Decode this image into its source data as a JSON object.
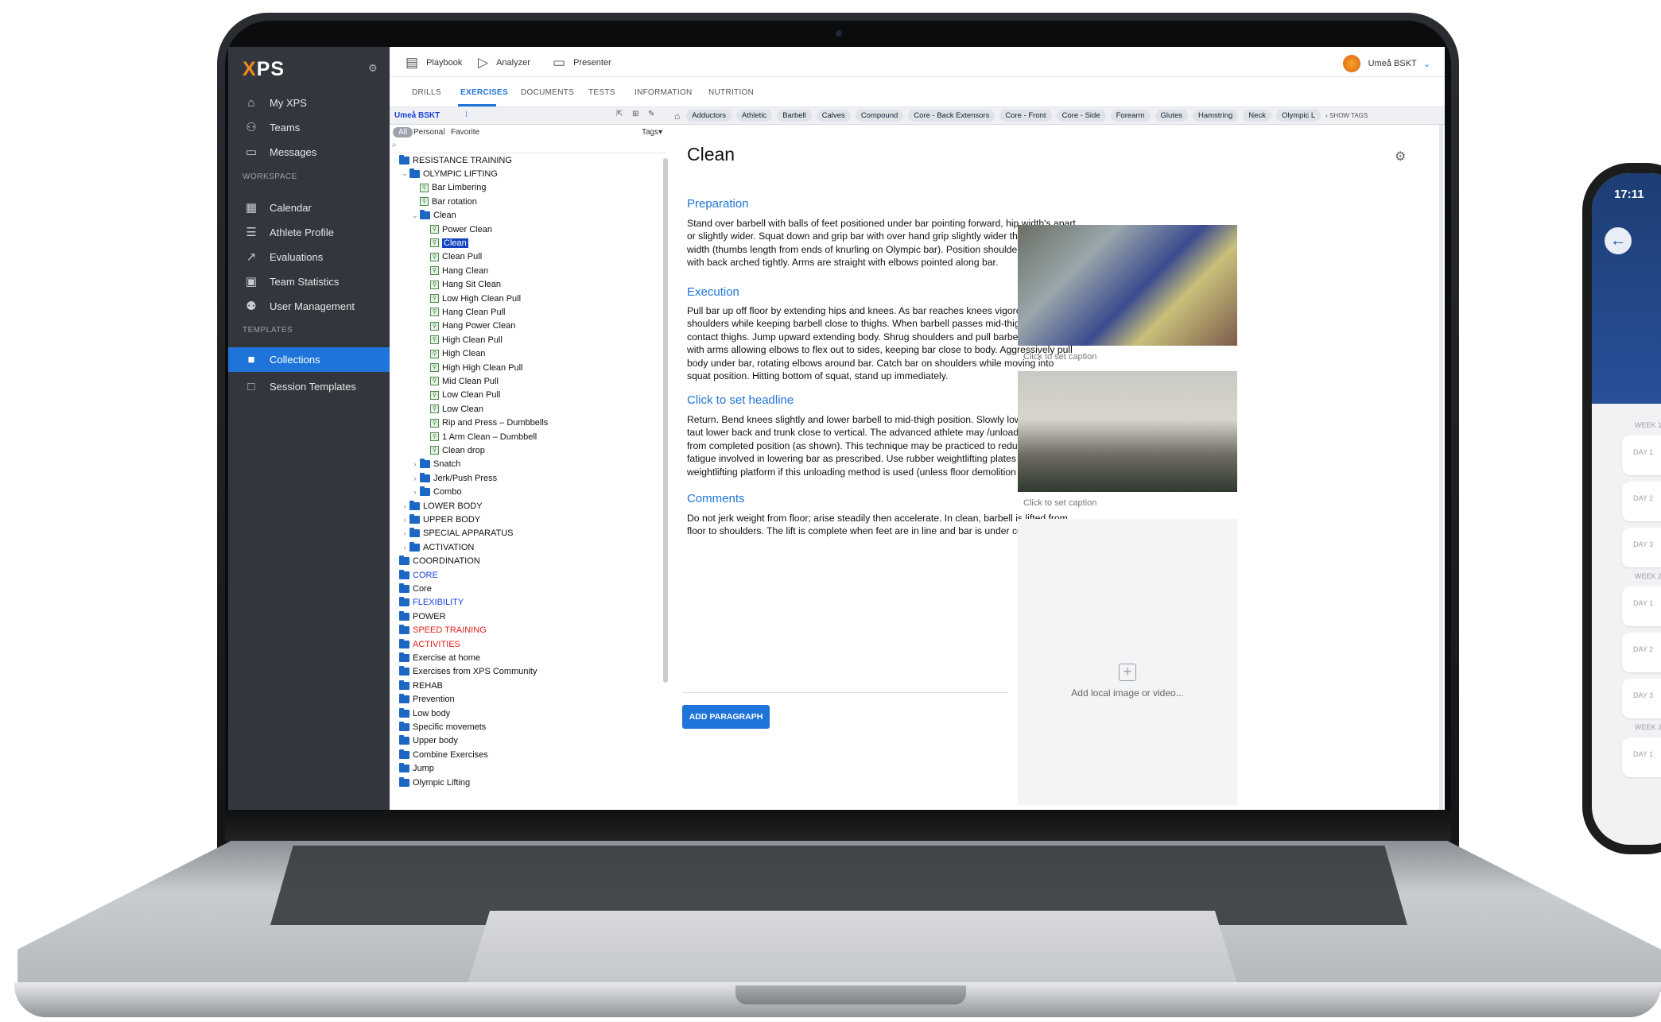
{
  "app": {
    "logo": "XPS",
    "sidebar": {
      "items": [
        {
          "label": "My XPS",
          "icon": "home-icon"
        },
        {
          "label": "Teams",
          "icon": "teams-icon"
        },
        {
          "label": "Messages",
          "icon": "chat-icon"
        }
      ],
      "workspace_label": "WORKSPACE",
      "workspace_items": [
        {
          "label": "Calendar",
          "icon": "calendar-icon"
        },
        {
          "label": "Athlete Profile",
          "icon": "profile-icon"
        },
        {
          "label": "Evaluations",
          "icon": "chart-icon"
        },
        {
          "label": "Team Statistics",
          "icon": "stats-icon"
        },
        {
          "label": "User Management",
          "icon": "users-icon"
        }
      ],
      "templates_label": "TEMPLATES",
      "template_items": [
        {
          "label": "Collections",
          "icon": "folder-icon",
          "active": true
        },
        {
          "label": "Session Templates",
          "icon": "folder-outline-icon"
        }
      ]
    },
    "topbar": {
      "playbook": "Playbook",
      "analyzer": "Analyzer",
      "presenter": "Presenter",
      "team": "Umeå BSKT"
    },
    "subnav": [
      "DRILLS",
      "EXERCISES",
      "DOCUMENTS",
      "TESTS",
      "INFORMATION",
      "NUTRITION"
    ],
    "subnav_active": "EXERCISES",
    "tree_header": {
      "team": "Umeå BSKT"
    },
    "filters": {
      "all": "All",
      "personal": "Personal",
      "favorite": "Favorite",
      "tags": "Tags"
    },
    "tree": [
      {
        "label": "RESISTANCE TRAINING",
        "level": 0,
        "kind": "folder"
      },
      {
        "label": "OLYMPIC LIFTING",
        "level": 1,
        "kind": "folder",
        "open": true
      },
      {
        "label": "Bar Limbering",
        "level": 2,
        "kind": "doc"
      },
      {
        "label": "Bar rotation",
        "level": 2,
        "kind": "doc"
      },
      {
        "label": "Clean",
        "level": 2,
        "kind": "folder",
        "open": true
      },
      {
        "label": "Power Clean",
        "level": 3,
        "kind": "doc"
      },
      {
        "label": "Clean",
        "level": 3,
        "kind": "doc",
        "selected": true
      },
      {
        "label": "Clean Pull",
        "level": 3,
        "kind": "doc"
      },
      {
        "label": "Hang Clean",
        "level": 3,
        "kind": "doc"
      },
      {
        "label": "Hang Sit Clean",
        "level": 3,
        "kind": "doc"
      },
      {
        "label": "Low High Clean Pull",
        "level": 3,
        "kind": "doc"
      },
      {
        "label": "Hang Clean Pull",
        "level": 3,
        "kind": "doc"
      },
      {
        "label": "Hang Power Clean",
        "level": 3,
        "kind": "doc"
      },
      {
        "label": "High Clean Pull",
        "level": 3,
        "kind": "doc"
      },
      {
        "label": "High Clean",
        "level": 3,
        "kind": "doc"
      },
      {
        "label": "High High Clean Pull",
        "level": 3,
        "kind": "doc"
      },
      {
        "label": "Mid Clean Pull",
        "level": 3,
        "kind": "doc"
      },
      {
        "label": "Low Clean Pull",
        "level": 3,
        "kind": "doc"
      },
      {
        "label": "Low Clean",
        "level": 3,
        "kind": "doc"
      },
      {
        "label": "Rip and Press – Dumbbells",
        "level": 3,
        "kind": "doc"
      },
      {
        "label": "1 Arm Clean – Dumbbell",
        "level": 3,
        "kind": "doc"
      },
      {
        "label": "Clean drop",
        "level": 3,
        "kind": "doc"
      },
      {
        "label": "Snatch",
        "level": 2,
        "kind": "folder",
        "collapsed": true
      },
      {
        "label": "Jerk/Push Press",
        "level": 2,
        "kind": "folder",
        "collapsed": true
      },
      {
        "label": "Combo",
        "level": 2,
        "kind": "folder",
        "collapsed": true
      },
      {
        "label": "LOWER BODY",
        "level": 1,
        "kind": "folder",
        "collapsed": true
      },
      {
        "label": "UPPER BODY",
        "level": 1,
        "kind": "folder",
        "collapsed": true
      },
      {
        "label": "SPECIAL APPARATUS",
        "level": 1,
        "kind": "folder",
        "collapsed": true
      },
      {
        "label": "ACTIVATION",
        "level": 1,
        "kind": "folder",
        "collapsed": true
      },
      {
        "label": "COORDINATION",
        "level": 0,
        "kind": "folder"
      },
      {
        "label": "CORE",
        "level": 0,
        "kind": "folder",
        "color": "blue"
      },
      {
        "label": "Core",
        "level": 0,
        "kind": "folder"
      },
      {
        "label": "FLEXIBILITY",
        "level": 0,
        "kind": "folder",
        "color": "blue"
      },
      {
        "label": "POWER",
        "level": 0,
        "kind": "folder"
      },
      {
        "label": "SPEED TRAINING",
        "level": 0,
        "kind": "folder",
        "color": "red"
      },
      {
        "label": "ACTIVITIES",
        "level": 0,
        "kind": "folder",
        "color": "red"
      },
      {
        "label": "Exercise at home",
        "level": 0,
        "kind": "folder"
      },
      {
        "label": "Exercises from XPS Community",
        "level": 0,
        "kind": "folder"
      },
      {
        "label": "REHAB",
        "level": 0,
        "kind": "folder"
      },
      {
        "label": "Prevention",
        "level": 0,
        "kind": "folder"
      },
      {
        "label": "Low body",
        "level": 0,
        "kind": "folder"
      },
      {
        "label": "Specific movemets",
        "level": 0,
        "kind": "folder"
      },
      {
        "label": "Upper body",
        "level": 0,
        "kind": "folder"
      },
      {
        "label": "Combine Exercises",
        "level": 0,
        "kind": "folder"
      },
      {
        "label": "Jump",
        "level": 0,
        "kind": "folder"
      },
      {
        "label": "Olympic Lifting",
        "level": 0,
        "kind": "folder"
      }
    ],
    "tags": [
      "Adductors",
      "Athletic",
      "Barbell",
      "Calves",
      "Compound",
      "Core - Back Extensors",
      "Core - Front",
      "Core - Side",
      "Forearm",
      "Glutes",
      "Hamstring",
      "Neck",
      "Olympic L"
    ],
    "show_tags": "‹ SHOW TAGS",
    "detail": {
      "title": "Clean",
      "sections": [
        {
          "headline": "Preparation",
          "text": "Stand over barbell with balls of feet positioned under bar pointing forward, hip width's apart or slightly wider. Squat down and grip bar with over hand grip slightly wider than shoulder width (thumbs length from ends of knurling on Olympic bar). Position shoulders over bar with back arched tightly. Arms are straight with elbows pointed along bar."
        },
        {
          "headline": "Execution",
          "text": "Pull bar up off floor by extending hips and knees. As bar reaches knees vigorously raise shoulders while keeping barbell close to thighs. When barbell passes mid-thigh, allow it to contact thighs. Jump upward extending body. Shrug shoulders and pull barbell upward with arms allowing elbows to flex out to sides, keeping bar close to body. Aggressively pull body under bar, rotating elbows around bar. Catch bar on shoulders while moving into squat position. Hitting bottom of squat, stand up immediately."
        },
        {
          "headline": "Click to set headline",
          "text": "Return. Bend knees slightly and lower barbell to mid-thigh position. Slowly lower bar with taut lower back and trunk close to vertical. The advanced athlete may /unload/ (drop) bar from completed position (as shown). This technique may be practiced to reduce stress or fatigue involved in lowering bar as prescribed. Use rubber weightlifting plates on weightlifting platform if this unloading method is used (unless floor demolition is desired)."
        },
        {
          "headline": "Comments",
          "text": "Do not jerk weight from floor; arise steadily then accelerate. In clean, barbell is lifted from floor to shoulders. The lift is complete when feet are in line and bar is under control."
        }
      ],
      "add_paragraph": "ADD PARAGRAPH",
      "caption1": "Click to set caption",
      "caption2": "Click to set caption",
      "add_media": "Add local image or video..."
    }
  },
  "phone": {
    "time": "17:11",
    "weeks": [
      "WEEK 1",
      "WEEK 2",
      "WEEK 3"
    ],
    "days": [
      "DAY 1",
      "DAY 2",
      "DAY 3",
      "DAY 1",
      "DAY 2",
      "DAY 3",
      "DAY 1"
    ]
  }
}
